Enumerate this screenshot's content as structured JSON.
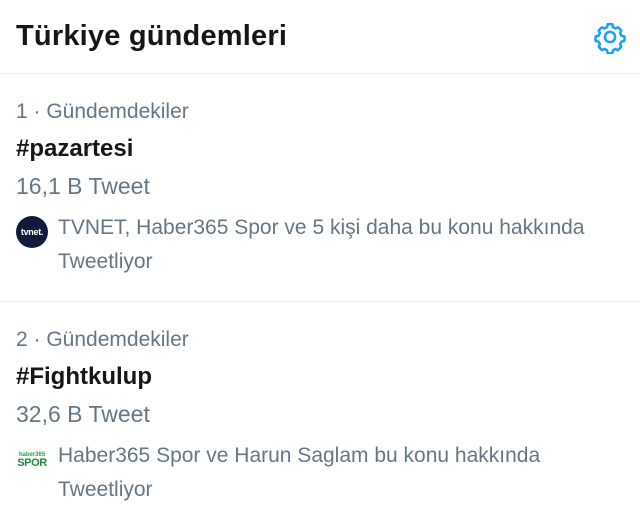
{
  "header": {
    "title": "Türkiye gündemleri",
    "settings_icon": "gear-icon",
    "accent_color": "#1da1f2"
  },
  "trends": [
    {
      "meta": "1 · Gündemdekiler",
      "name": "#pazartesi",
      "count": "16,1 B Tweet",
      "avatar_label": "tvnet.",
      "context": "TVNET, Haber365 Spor ve 5 kişi daha bu konu hakkında Tweetliyor"
    },
    {
      "meta": "2 · Gündemdekiler",
      "name": "#Fightkulup",
      "count": "32,6 B Tweet",
      "avatar_label_top": "haber365",
      "avatar_label_bottom": "SPOR",
      "context": "Haber365 Spor ve Harun Saglam bu konu hakkında Tweetliyor"
    }
  ]
}
